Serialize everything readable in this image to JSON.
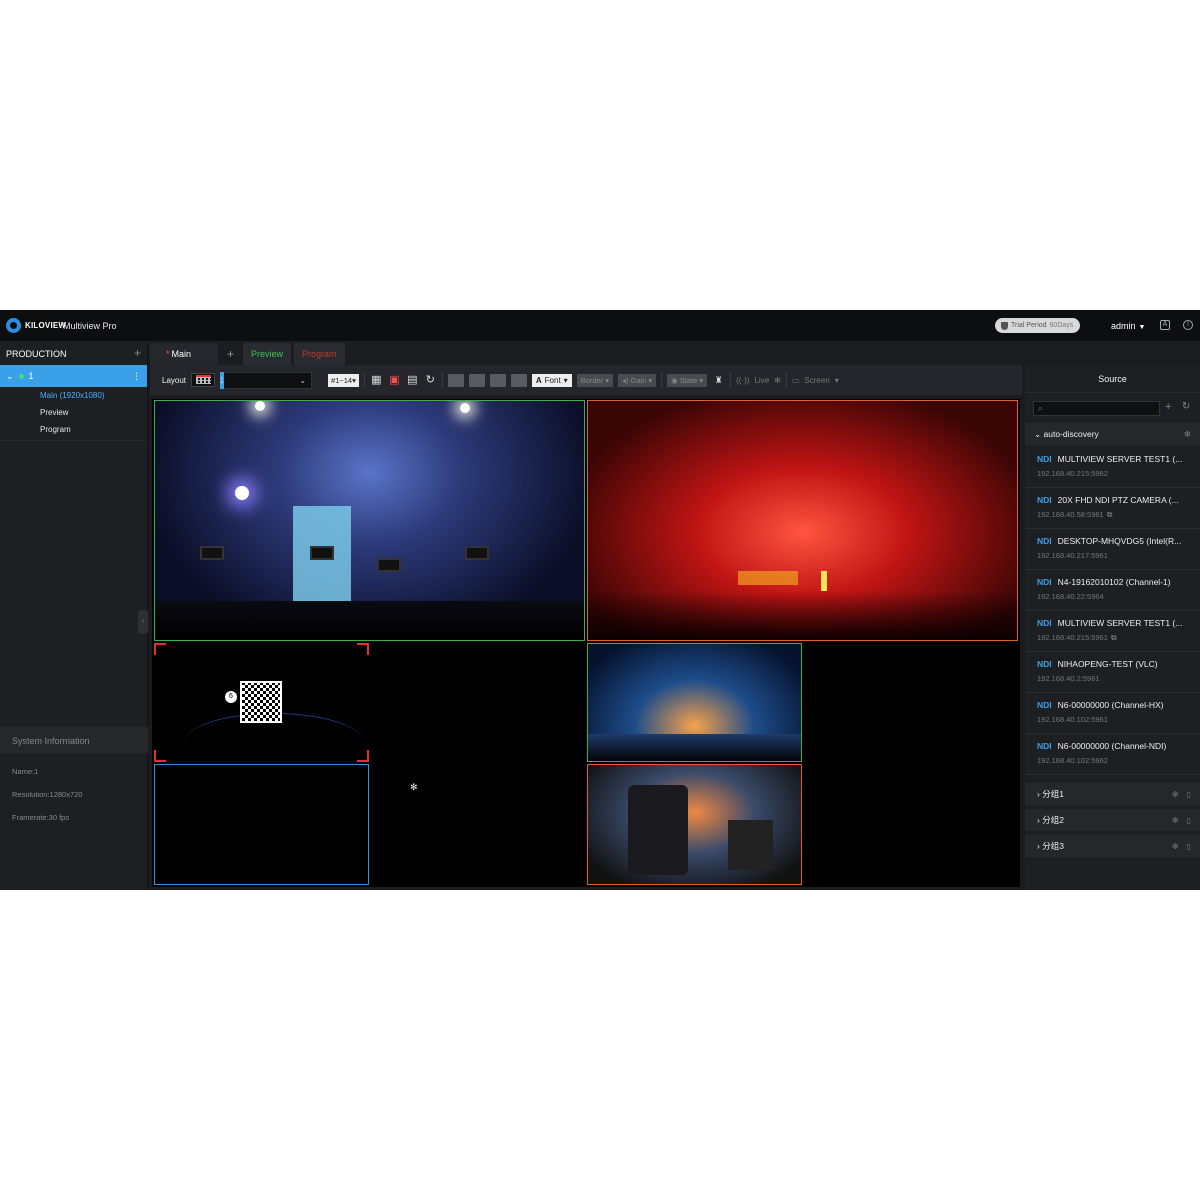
{
  "app": {
    "logo": "KILOVIEW",
    "title": "Multiview Pro"
  },
  "header": {
    "trial_label": "Trial Period",
    "trial_days": "60Days",
    "user": "admin"
  },
  "sidebar": {
    "title": "PRODUCTION",
    "project": "1",
    "items": [
      {
        "label": "Main (1920x1080)",
        "active": true
      },
      {
        "label": "Preview",
        "active": false
      },
      {
        "label": "Program",
        "active": false
      }
    ],
    "system_info_title": "System Information",
    "system_info": {
      "name": "Name:1",
      "resolution": "Resolution:1280x720",
      "framerate": "Framerate:30 fps"
    }
  },
  "tabs": [
    {
      "label": "Main",
      "modified": true
    },
    {
      "label": "Preview"
    },
    {
      "label": "Program"
    }
  ],
  "toolbar": {
    "layout_label": "Layout",
    "layout_value": "1",
    "range_value": "#1~14",
    "font_label": "Font",
    "border_label": "Border",
    "gain_label": "Gain",
    "state_label": "State",
    "live_label": "Live",
    "screen_label": "Screen"
  },
  "canvas": {
    "badge": "6"
  },
  "source_panel": {
    "title": "Source",
    "search_placeholder": "",
    "group": "auto-discovery",
    "sources": [
      {
        "type": "NDI",
        "name": "MULTIVIEW SERVER TEST1 (...",
        "ip": "192.168.40.215:5962",
        "link": false
      },
      {
        "type": "NDI",
        "name": "20X FHD NDI PTZ CAMERA (...",
        "ip": "192.168.40.58:5961",
        "link": true
      },
      {
        "type": "NDI",
        "name": "DESKTOP-MHQVDG5 (Intel(R...",
        "ip": "192.168.40.217:5961",
        "link": false
      },
      {
        "type": "NDI",
        "name": "N4-19162010102 (Channel-1)",
        "ip": "192.168.40.22:5964",
        "link": false
      },
      {
        "type": "NDI",
        "name": "MULTIVIEW SERVER TEST1 (...",
        "ip": "192.168.40.215:5961",
        "link": true
      },
      {
        "type": "NDI",
        "name": "NIHAOPENG-TEST (VLC)",
        "ip": "192.168.40.2:5961",
        "link": false
      },
      {
        "type": "NDI",
        "name": "N6-00000000 (Channel-HX)",
        "ip": "192.168.40.102:5961",
        "link": false
      },
      {
        "type": "NDI",
        "name": "N6-00000000 (Channel-NDI)",
        "ip": "192.168.40.102:5962",
        "link": false
      }
    ],
    "groups": [
      "分组1",
      "分组2",
      "分组3"
    ]
  },
  "colors": {
    "accent": "#3aa1e8",
    "preview": "#3ec05a",
    "program": "#c0392b",
    "green_border": "#3cb048",
    "orange_border": "#e0602a"
  }
}
